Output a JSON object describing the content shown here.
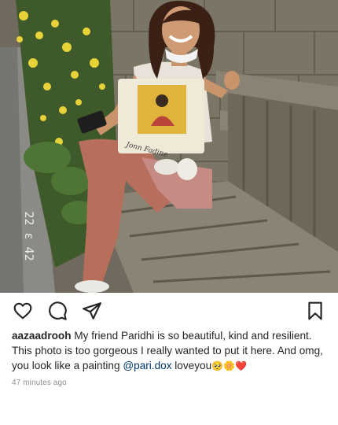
{
  "photo": {
    "alt_icon": "photo",
    "overlay_text": "22 ε 42",
    "tote_text": "Jonn Fadine"
  },
  "actions": {
    "like_icon": "heart-outline-icon",
    "comment_icon": "comment-bubble-icon",
    "share_icon": "paper-plane-icon",
    "save_icon": "bookmark-icon"
  },
  "caption": {
    "username": "aazaadrooh",
    "text_before_mention": " My friend Paridhi is so beautiful, kind and resilient. This photo is too gorgeous I really wanted to put it here. And omg, you look like a painting ",
    "mention": "@pari.dox",
    "text_after_mention": " loveyou",
    "emojis": "🥺🌼❤️"
  },
  "timestamp": "47 minutes ago",
  "colors": {
    "text": "#262626",
    "mention": "#00376b",
    "muted": "#8e8e8e"
  }
}
